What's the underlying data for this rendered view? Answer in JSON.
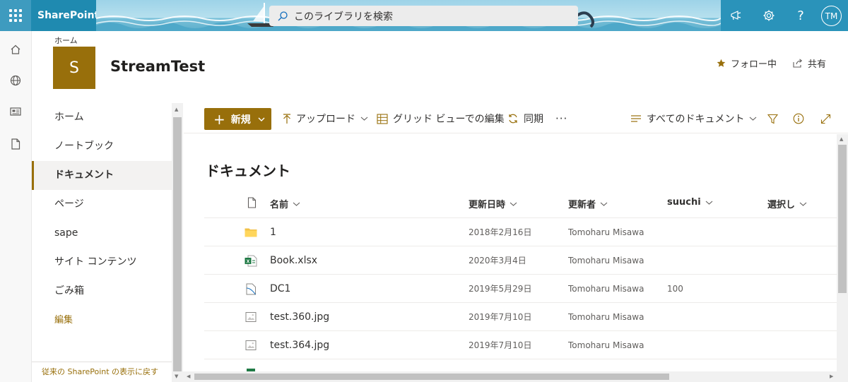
{
  "suite": {
    "brand": "SharePoint",
    "search_placeholder": "このライブラリを検索",
    "avatar_initials": "TM",
    "theme_color": "#3e9bbf"
  },
  "site": {
    "breadcrumb": "ホーム",
    "logo_letter": "S",
    "title": "StreamTest",
    "follow_label": "フォロー中",
    "share_label": "共有",
    "accent_color": "#986f0b"
  },
  "quicklaunch": {
    "items": [
      {
        "label": "ホーム"
      },
      {
        "label": "ノートブック"
      },
      {
        "label": "ドキュメント"
      },
      {
        "label": "ページ"
      },
      {
        "label": "sape"
      },
      {
        "label": "サイト コンテンツ"
      },
      {
        "label": "ごみ箱"
      }
    ],
    "edit_label": "編集",
    "classic_link": "従来の SharePoint の表示に戻す"
  },
  "commandbar": {
    "new_label": "新規",
    "upload_label": "アップロード",
    "grid_edit_label": "グリッド ビューでの編集",
    "sync_label": "同期",
    "more_label": "···",
    "view_label": "すべてのドキュメント"
  },
  "library": {
    "title": "ドキュメント",
    "columns": {
      "name": "名前",
      "modified": "更新日時",
      "modified_by": "更新者",
      "suuchi": "suuchi",
      "choice": "選択し"
    },
    "rows": [
      {
        "icon": "folder-icon",
        "name": "1",
        "modified": "2018年2月16日",
        "modified_by": "Tomoharu Misawa",
        "suuchi": ""
      },
      {
        "icon": "excel-file-icon",
        "name": "Book.xlsx",
        "modified": "2020年3月4日",
        "modified_by": "Tomoharu Misawa",
        "suuchi": ""
      },
      {
        "icon": "document-file-icon",
        "name": "DC1",
        "modified": "2019年5月29日",
        "modified_by": "Tomoharu Misawa",
        "suuchi": "100"
      },
      {
        "icon": "image-file-icon",
        "name": "test.360.jpg",
        "modified": "2019年7月10日",
        "modified_by": "Tomoharu Misawa",
        "suuchi": ""
      },
      {
        "icon": "image-file-icon",
        "name": "test.364.jpg",
        "modified": "2019年7月10日",
        "modified_by": "Tomoharu Misawa",
        "suuchi": ""
      }
    ]
  }
}
